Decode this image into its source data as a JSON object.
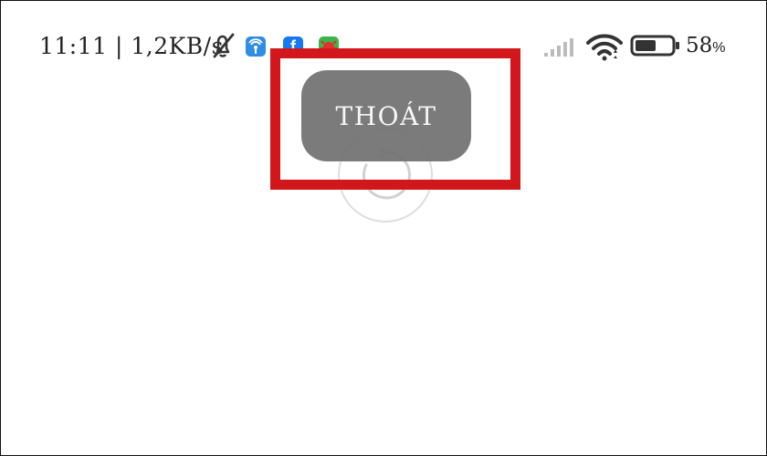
{
  "status_bar": {
    "time_speed": "11:11 | 1,2KB/s",
    "battery_value": "58",
    "battery_unit": "%",
    "battery_level": 0.58,
    "icons": [
      "bell-off-icon",
      "wifi-app-icon",
      "facebook-icon",
      "antivirus-app-icon",
      "signal-icon",
      "wifi-icon",
      "battery-icon"
    ],
    "facebook_letter": "f"
  },
  "dialog": {
    "exit_label": "THOÁT"
  },
  "colors": {
    "highlight": "#d1161c",
    "button": "#707070",
    "wifi_app": "#2f8de4",
    "facebook": "#1877f2",
    "antivirus_app": "#39b54a"
  }
}
